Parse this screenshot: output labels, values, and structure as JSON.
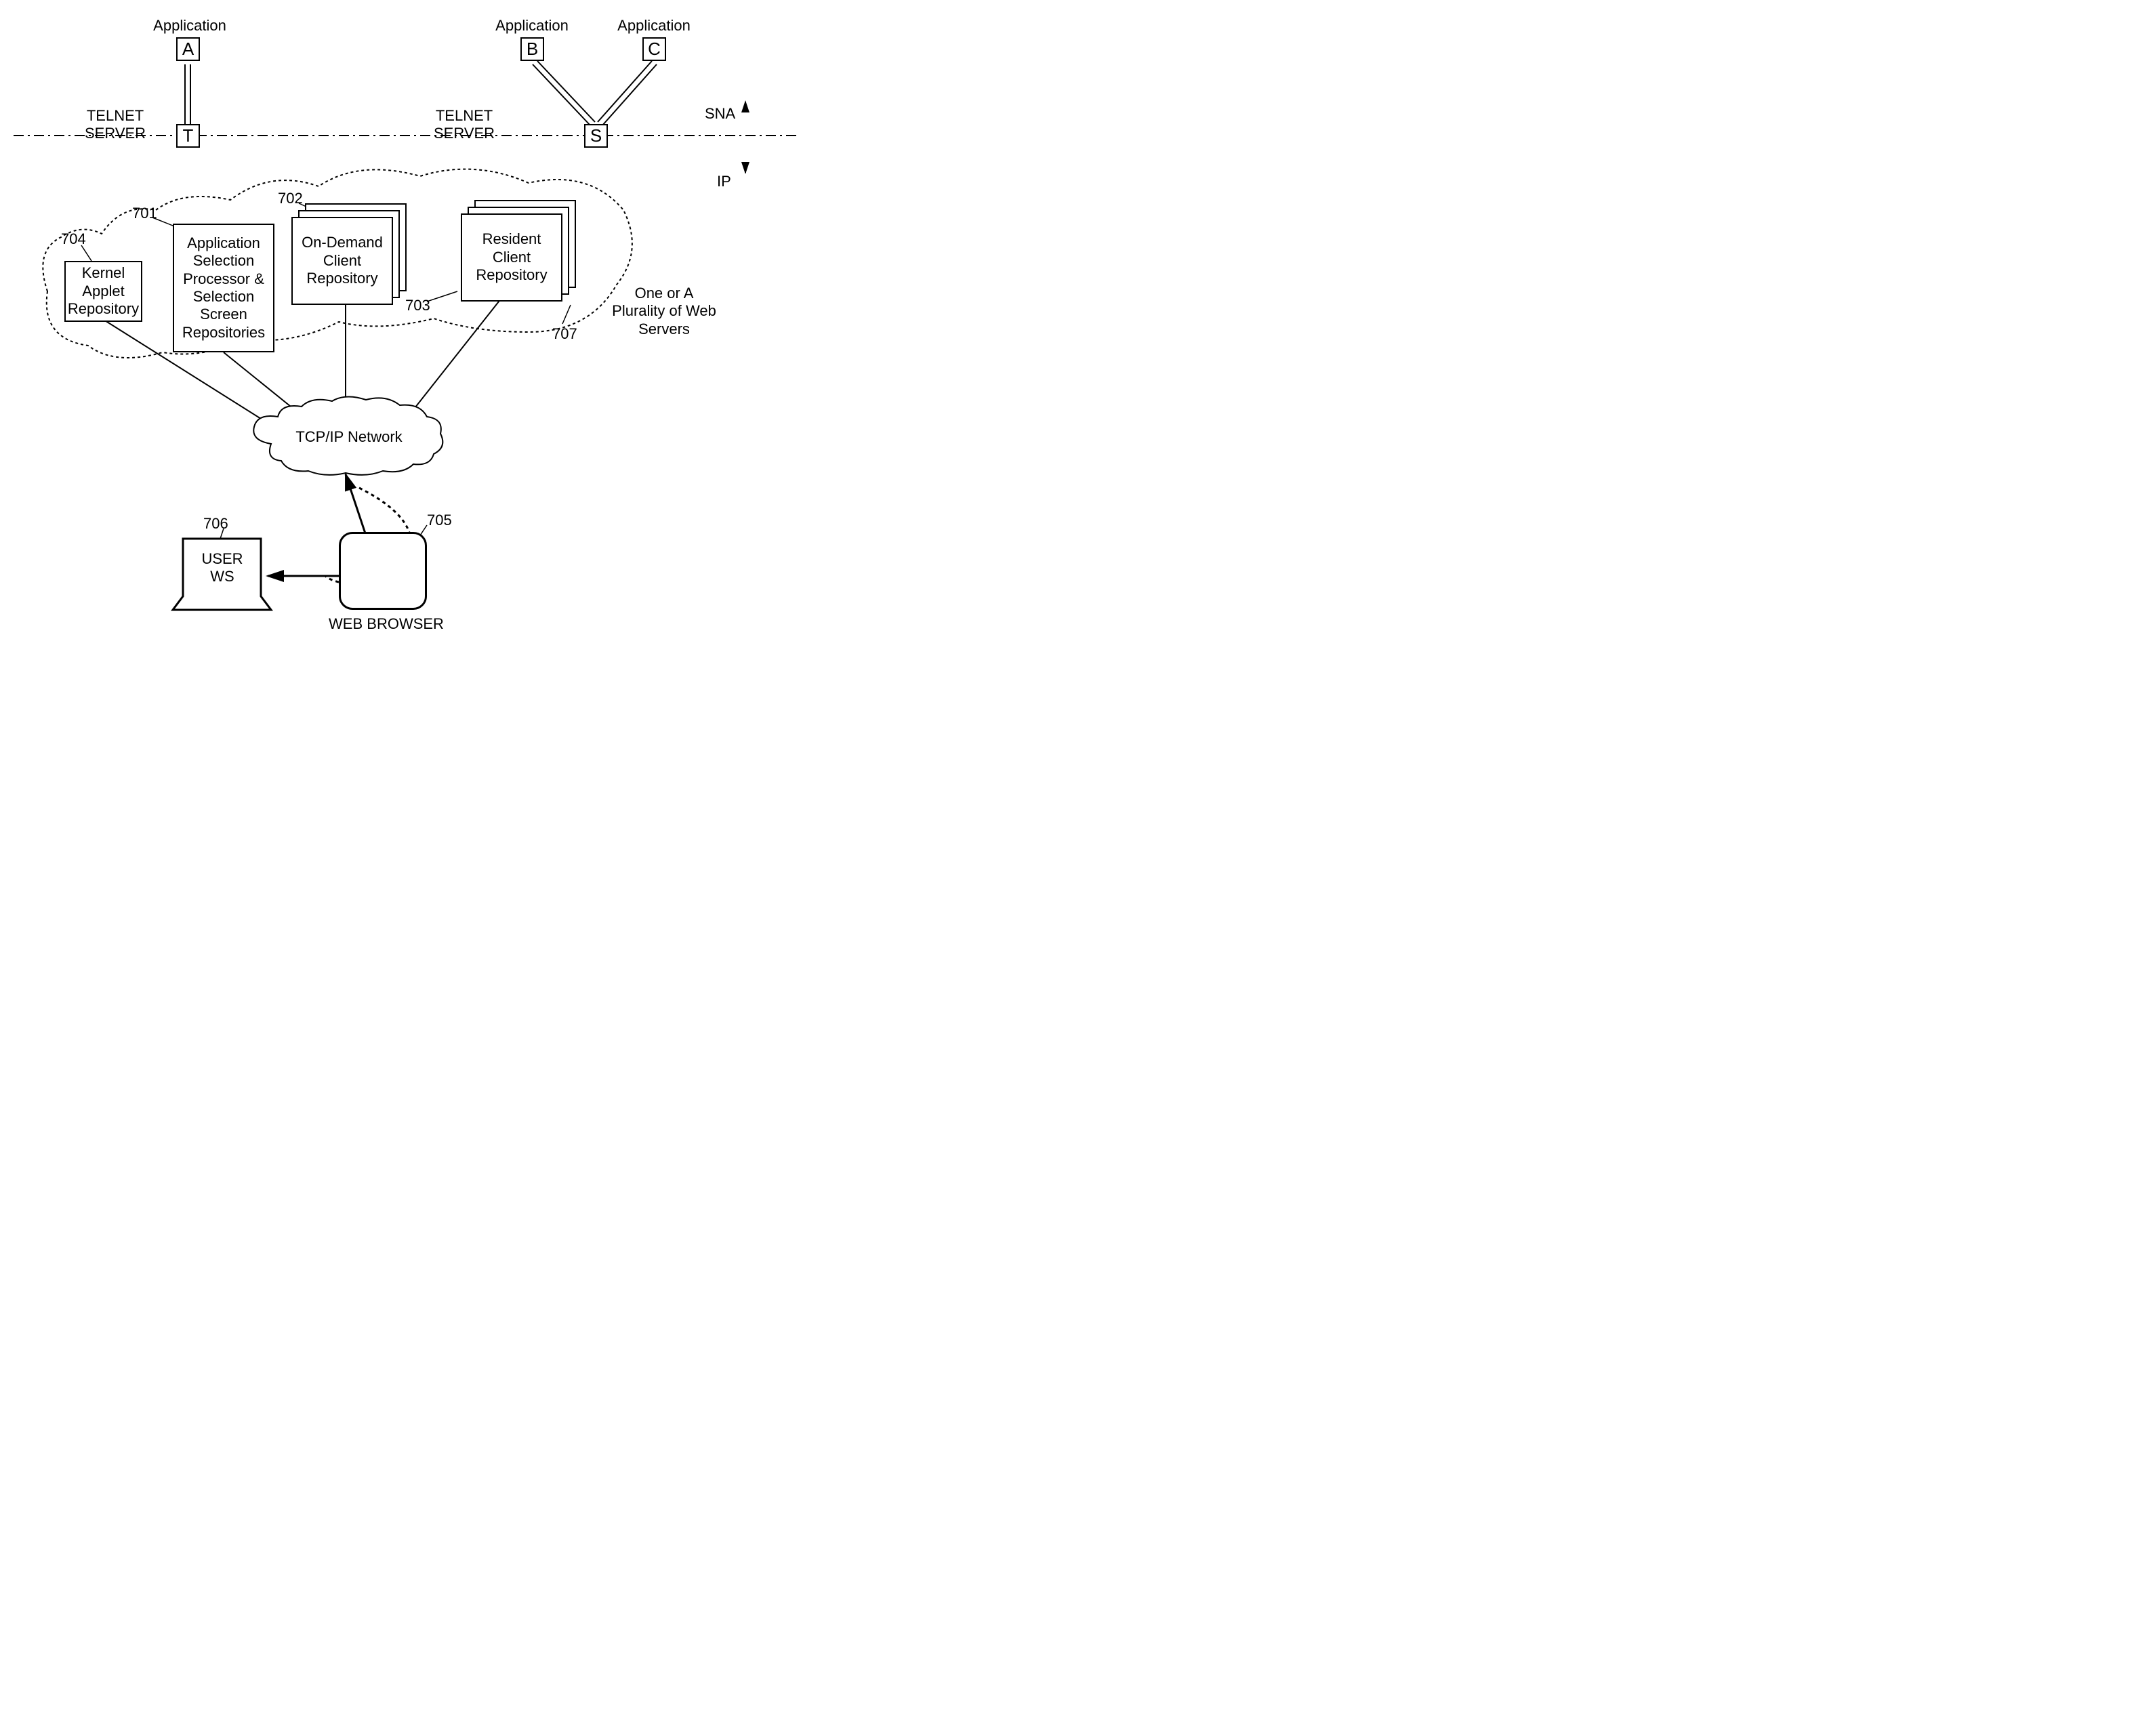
{
  "apps": {
    "a_label": "Application",
    "a_letter": "A",
    "b_label": "Application",
    "b_letter": "B",
    "c_label": "Application",
    "c_letter": "C"
  },
  "telnet": {
    "left_label": "TELNET\nSERVER",
    "left_letter": "T",
    "right_label": "TELNET\nSERVER",
    "right_letter": "S"
  },
  "boundary": {
    "upper": "SNA",
    "lower": "IP"
  },
  "boxes": {
    "kernel": "Kernel\nApplet\nRepository",
    "kernel_ref": "704",
    "aspp": "Application\nSelection\nProcessor &\nSelection\nScreen\nRepositories",
    "aspp_ref": "701",
    "ondemand": "On-Demand\nClient\nRepository",
    "ondemand_ref": "702",
    "resident": "Resident\nClient\nRepository",
    "resident_ref": "703",
    "blob_ref": "707",
    "blob_label": "One or A\nPlurality of Web\nServers"
  },
  "network": {
    "cloud": "TCP/IP Network"
  },
  "bottom": {
    "user_ws": "USER\nWS",
    "user_ws_ref": "706",
    "browser_label": "WEB BROWSER",
    "browser_ref": "705"
  }
}
